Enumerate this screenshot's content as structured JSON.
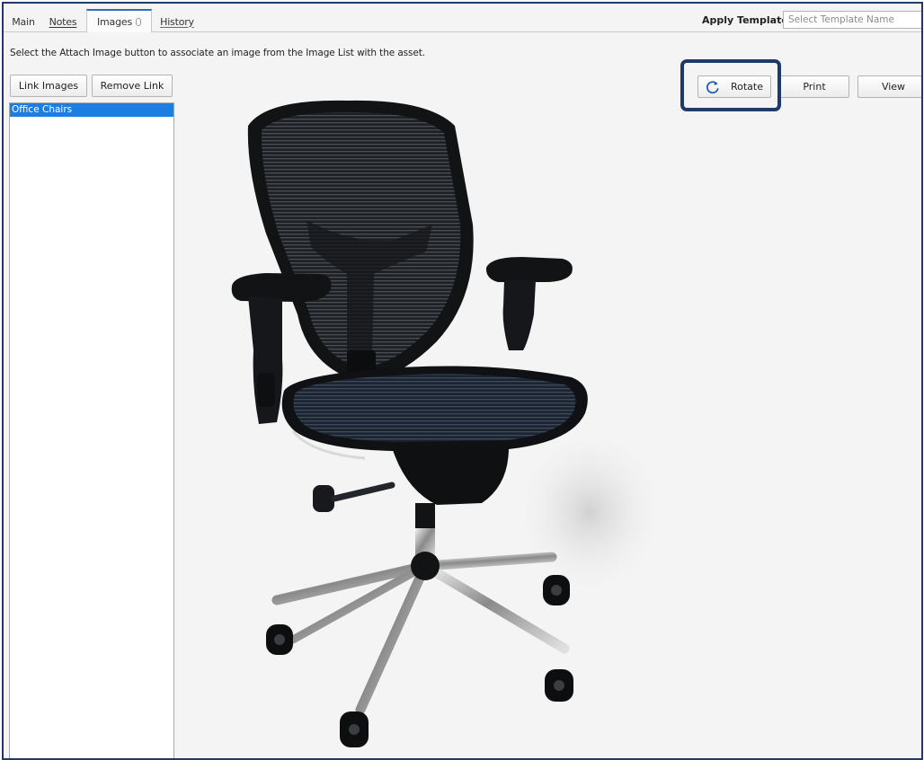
{
  "tabs": [
    {
      "label": "Main"
    },
    {
      "label": "Notes"
    },
    {
      "label": "Images"
    },
    {
      "label": "History"
    }
  ],
  "template": {
    "label": "Apply Template:",
    "placeholder": "Select Template Name"
  },
  "instruction": "Select the Attach Image button to associate an image from the Image List with the asset.",
  "buttons": {
    "link_images": "Link Images",
    "remove_link": "Remove Link",
    "rotate": "Rotate",
    "print": "Print",
    "view": "View"
  },
  "image_list": {
    "items": [
      {
        "label": "Office Chairs",
        "selected": true
      }
    ]
  },
  "preview": {
    "subject": "office-chair-photo"
  },
  "colors": {
    "highlight_border": "#1f3a68",
    "selection": "#1b7ee0",
    "active_tab_accent": "#2e6fc1"
  }
}
